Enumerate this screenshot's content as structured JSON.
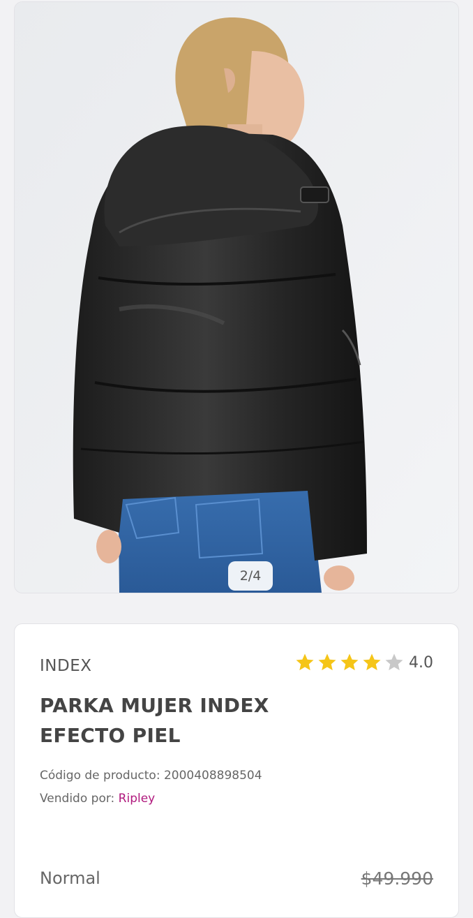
{
  "gallery": {
    "image_alt": "Mujer de espaldas usando parka negra acolchada efecto piel con capucha y jeans",
    "counter": "2/4"
  },
  "product": {
    "brand": "INDEX",
    "rating": {
      "value": "4.0",
      "stars_filled": 4,
      "stars_total": 5,
      "color_filled": "#f5c518",
      "color_empty": "#c8c8c8"
    },
    "title_line1": "PARKA MUJER INDEX",
    "title_line2": "EFECTO PIEL",
    "code_label": "Código de producto: 2000408898504",
    "seller_label": "Vendido por: ",
    "seller_name": "Ripley",
    "seller_color": "#b0197d"
  },
  "pricing": {
    "normal_label": "Normal",
    "normal_price": "$49.990"
  }
}
